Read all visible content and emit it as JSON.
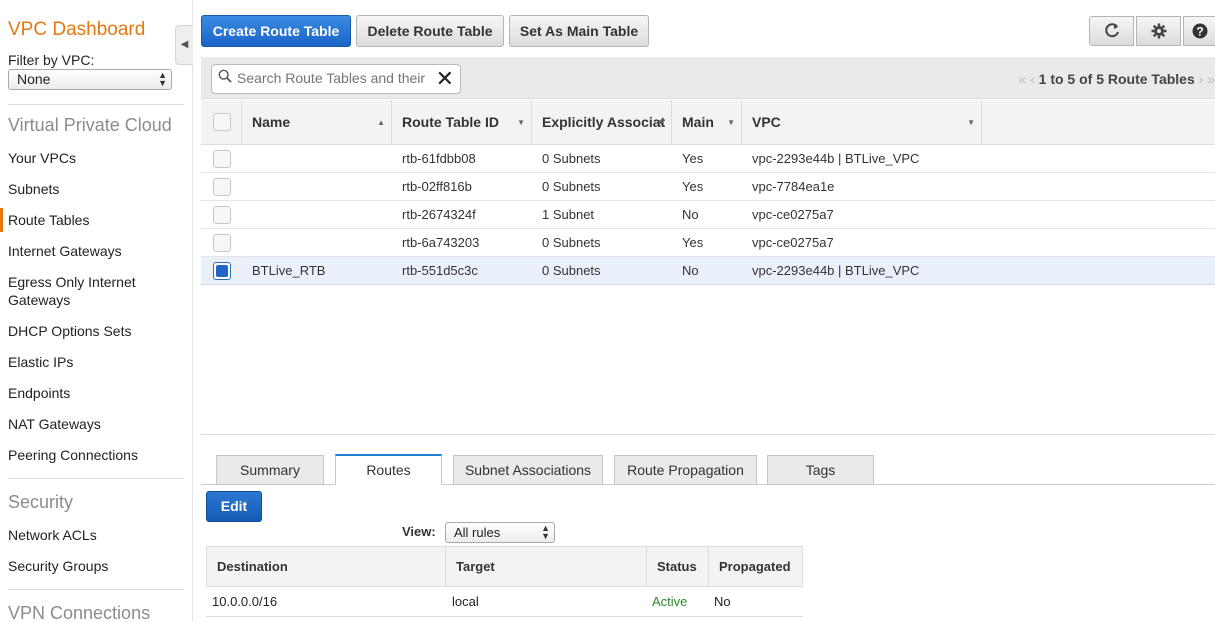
{
  "sidebar": {
    "title": "VPC Dashboard",
    "filter_label": "Filter by VPC:",
    "filter_value": "None",
    "section_vpc": "Virtual Private Cloud",
    "items_vpc": [
      "Your VPCs",
      "Subnets",
      "Route Tables",
      "Internet Gateways",
      "Egress Only Internet Gateways",
      "DHCP Options Sets",
      "Elastic IPs",
      "Endpoints",
      "NAT Gateways",
      "Peering Connections"
    ],
    "active_item": "Route Tables",
    "section_security": "Security",
    "items_security": [
      "Network ACLs",
      "Security Groups"
    ],
    "section_vpn": "VPN Connections"
  },
  "toolbar": {
    "create_label": "Create Route Table",
    "delete_label": "Delete Route Table",
    "set_main_label": "Set As Main Table"
  },
  "icons": {
    "refresh": "refresh-icon",
    "settings": "gear-icon",
    "help": "help-icon"
  },
  "search": {
    "placeholder": "Search Route Tables and their"
  },
  "pager": {
    "text": "1 to 5 of 5 Route Tables"
  },
  "columns": [
    "Name",
    "Route Table ID",
    "Explicitly Associat",
    "Main",
    "VPC"
  ],
  "rows": [
    {
      "name": "",
      "id": "rtb-61fdbb08",
      "assoc": "0 Subnets",
      "main": "Yes",
      "vpc": "vpc-2293e44b | BTLive_VPC",
      "selected": false
    },
    {
      "name": "",
      "id": "rtb-02ff816b",
      "assoc": "0 Subnets",
      "main": "Yes",
      "vpc": "vpc-7784ea1e",
      "selected": false
    },
    {
      "name": "",
      "id": "rtb-2674324f",
      "assoc": "1 Subnet",
      "main": "No",
      "vpc": "vpc-ce0275a7",
      "selected": false
    },
    {
      "name": "",
      "id": "rtb-6a743203",
      "assoc": "0 Subnets",
      "main": "Yes",
      "vpc": "vpc-ce0275a7",
      "selected": false
    },
    {
      "name": "BTLive_RTB",
      "id": "rtb-551d5c3c",
      "assoc": "0 Subnets",
      "main": "No",
      "vpc": "vpc-2293e44b | BTLive_VPC",
      "selected": true
    }
  ],
  "tabs": [
    "Summary",
    "Routes",
    "Subnet Associations",
    "Route Propagation",
    "Tags"
  ],
  "active_tab": "Routes",
  "details": {
    "edit_label": "Edit",
    "view_label": "View:",
    "view_value": "All rules",
    "route_columns": [
      "Destination",
      "Target",
      "Status",
      "Propagated"
    ],
    "routes": [
      {
        "destination": "10.0.0.0/16",
        "target": "local",
        "status": "Active",
        "propagated": "No"
      }
    ]
  },
  "colors": {
    "accent": "#e47911",
    "primary_button": "#1b64c8",
    "status_active": "#2e8b2e"
  }
}
